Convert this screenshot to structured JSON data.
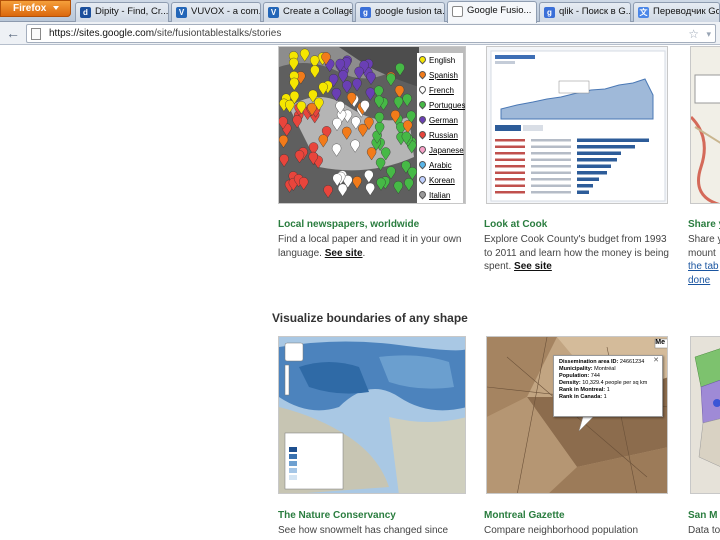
{
  "browser": {
    "menu_label": "Firefox",
    "tabs": [
      {
        "label": "Dipity - Find, Cr...",
        "favicon": "dipity-icon",
        "icon_text": "d",
        "color": "#1b4f9c"
      },
      {
        "label": "VUVOX - a com...",
        "favicon": "vuvox-icon",
        "icon_text": "V",
        "color": "#2366b8"
      },
      {
        "label": "Create a Collage ...",
        "favicon": "vuvox-icon",
        "icon_text": "V",
        "color": "#2366b8"
      },
      {
        "label": "google fusion ta...",
        "favicon": "google-icon",
        "icon_text": "g",
        "color": "#3a6fd8"
      },
      {
        "label": "Google Fusio...",
        "favicon": "page-icon",
        "icon_text": "",
        "color": "#ffffff"
      },
      {
        "label": "qlik - Поиск в G...",
        "favicon": "google-icon",
        "icon_text": "g",
        "color": "#3a6fd8"
      },
      {
        "label": "Переводчик Go...",
        "favicon": "translate-icon",
        "icon_text": "文",
        "color": "#4a86e8"
      }
    ],
    "active_tab": 4,
    "url_host": "https://sites.google.com",
    "url_path": "/site/fusiontablestalks/stories"
  },
  "section_heading": "Visualize boundaries of any shape",
  "cards": {
    "local_newspapers": {
      "title": "Local newspapers, worldwide",
      "desc_text": "Find a local paper and read it in your own language.",
      "link": "See site",
      "desc_end": ".",
      "legend": [
        {
          "label": "English",
          "color": "#f5e600"
        },
        {
          "label": "Spanish",
          "color": "#f27b1a"
        },
        {
          "label": "French",
          "color": "#ffffff"
        },
        {
          "label": "Portuguese",
          "color": "#46b946"
        },
        {
          "label": "German",
          "color": "#6a3fb5"
        },
        {
          "label": "Russian",
          "color": "#e8453c"
        },
        {
          "label": "Japanese",
          "color": "#f7a0c8"
        },
        {
          "label": "Arabic",
          "color": "#5bb6e8"
        },
        {
          "label": "Korean",
          "color": "#c0d0ff"
        },
        {
          "label": "Italian",
          "color": "#9a9a9a"
        }
      ]
    },
    "look_at_cook": {
      "title": "Look at Cook",
      "desc_text": "Explore Cook County's budget from 1993 to 2011 and learn how the money is being spent.",
      "link": "See site",
      "desc_end": ""
    },
    "share": {
      "title": "Share y",
      "desc_lines": [
        "Share y",
        "mount",
        "the tab",
        "done"
      ]
    },
    "nature_conservancy": {
      "title": "The Nature Conservancy",
      "desc_text": "See how snowmelt has changed since"
    },
    "montreal_gazette": {
      "title": "Montreal Gazette",
      "desc_text": "Compare neighborhood population",
      "badge": "Me",
      "popup": {
        "lines": [
          {
            "k": "Dissemination area ID:",
            "v": "24661234"
          },
          {
            "k": "Municipality:",
            "v": "Montréal"
          },
          {
            "k": "Population:",
            "v": "744"
          },
          {
            "k": "Density:",
            "v": "10,329.4 people per sq km"
          },
          {
            "k": "Rank in Montreal:",
            "v": "1"
          },
          {
            "k": "Rank in Canada:",
            "v": "1"
          }
        ]
      }
    },
    "san": {
      "title": "San M",
      "desc_text": "Data to"
    }
  }
}
